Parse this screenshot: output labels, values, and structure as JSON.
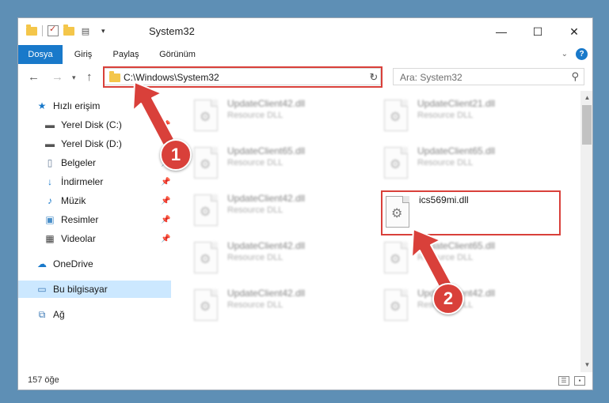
{
  "window": {
    "title": "System32"
  },
  "ribbon": {
    "tabs": [
      {
        "label": "Dosya",
        "active": true
      },
      {
        "label": "Giriş",
        "active": false
      },
      {
        "label": "Paylaş",
        "active": false
      },
      {
        "label": "Görünüm",
        "active": false
      }
    ],
    "help_label": "?"
  },
  "window_controls": {
    "minimize": "—",
    "maximize": "☐",
    "close": "✕"
  },
  "address": {
    "path": "C:\\Windows\\System32",
    "search_placeholder": "Ara: System32"
  },
  "sidebar": {
    "items": [
      {
        "label": "Hızlı erişim",
        "icon": "star-icon"
      },
      {
        "label": "Yerel Disk (C:)",
        "icon": "drive-icon"
      },
      {
        "label": "Yerel Disk (D:)",
        "icon": "drive-icon"
      },
      {
        "label": "Belgeler",
        "icon": "documents-icon"
      },
      {
        "label": "İndirmeler",
        "icon": "download-icon"
      },
      {
        "label": "Müzik",
        "icon": "music-icon"
      },
      {
        "label": "Resimler",
        "icon": "pictures-icon"
      },
      {
        "label": "Videolar",
        "icon": "video-icon"
      },
      {
        "label": "OneDrive",
        "icon": "cloud-icon"
      },
      {
        "label": "Bu bilgisayar",
        "icon": "computer-icon",
        "selected": true
      },
      {
        "label": "Ağ",
        "icon": "network-icon"
      }
    ]
  },
  "files": [
    {
      "name": "UpdateClient42.dll",
      "type": "Resource DLL"
    },
    {
      "name": "UpdateClient21.dll",
      "type": "Resource DLL"
    },
    {
      "name": "UpdateClient65.dll",
      "type": "Resource DLL"
    },
    {
      "name": "UpdateClient65.dll",
      "type": "Resource DLL"
    },
    {
      "name": "UpdateClient42.dll",
      "type": "Resource DLL"
    },
    {
      "name": "ics569mi.dll",
      "type": "",
      "highlighted": true
    },
    {
      "name": "UpdateClient42.dll",
      "type": "Resource DLL"
    },
    {
      "name": "UpdateClient65.dll",
      "type": "Resource DLL"
    },
    {
      "name": "UpdateClient42.dll",
      "type": "Resource DLL"
    },
    {
      "name": "UpdateClient42.dll",
      "type": "Resource DLL"
    }
  ],
  "status": {
    "item_count": "157 öğe"
  },
  "callouts": {
    "step1": "1",
    "step2": "2"
  },
  "colors": {
    "accent": "#1979ca",
    "highlight": "#d9403a",
    "selected_bg": "#cce8ff"
  }
}
